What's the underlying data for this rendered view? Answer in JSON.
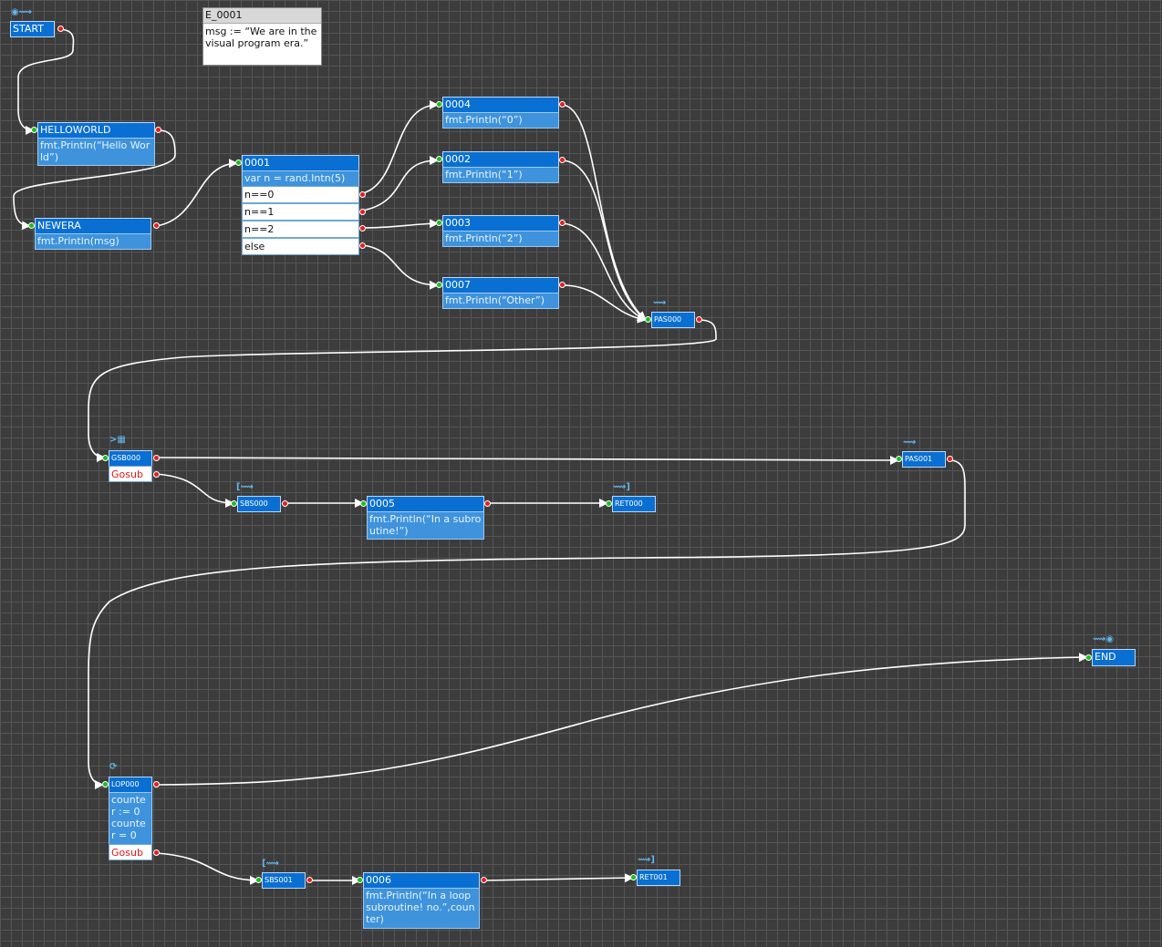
{
  "note": {
    "title": "E_0001",
    "text": "msg := “We are in the visual program era.”"
  },
  "nodes": {
    "start": {
      "label": "START"
    },
    "helloworld": {
      "label": "HELLOWORLD",
      "code": "fmt.Println(“Hello World”)"
    },
    "newera": {
      "label": "NEWERA",
      "code": "fmt.Println(msg)"
    },
    "n0001": {
      "label": "0001",
      "code": "var n = rand.Intn(5)",
      "cases": [
        "n==0",
        "n==1",
        "n==2",
        "else"
      ]
    },
    "n0004": {
      "label": "0004",
      "code": "fmt.Println(“0”)"
    },
    "n0002": {
      "label": "0002",
      "code": "fmt.Println(“1”)"
    },
    "n0003": {
      "label": "0003",
      "code": "fmt.Println(“2”)"
    },
    "n0007": {
      "label": "0007",
      "code": "fmt.Println(“Other”)"
    },
    "pas000": {
      "label": "PAS000"
    },
    "gsb000": {
      "label": "GSB000",
      "gosub": "Gosub"
    },
    "pas001": {
      "label": "PAS001"
    },
    "sbs000": {
      "label": "SBS000"
    },
    "n0005": {
      "label": "0005",
      "code": "fmt.Println(“In a subroutine!”)"
    },
    "ret000": {
      "label": "RET000"
    },
    "end": {
      "label": "END"
    },
    "lop000": {
      "label": "LOP000",
      "code": "counter := 0\ncounter = 0",
      "gosub": "Gosub"
    },
    "sbs001": {
      "label": "SBS001"
    },
    "n0006": {
      "label": "0006",
      "code": "fmt.Println(“In a loop subroutine! no.”,counter)"
    },
    "ret001": {
      "label": "RET001"
    }
  },
  "colors": {
    "header": "#0a6fd2",
    "body": "#3e93dc",
    "in_pin": "#18c018",
    "out_pin": "#e51d1d",
    "wire": "#ffffff",
    "background": "#3c3c3c"
  }
}
